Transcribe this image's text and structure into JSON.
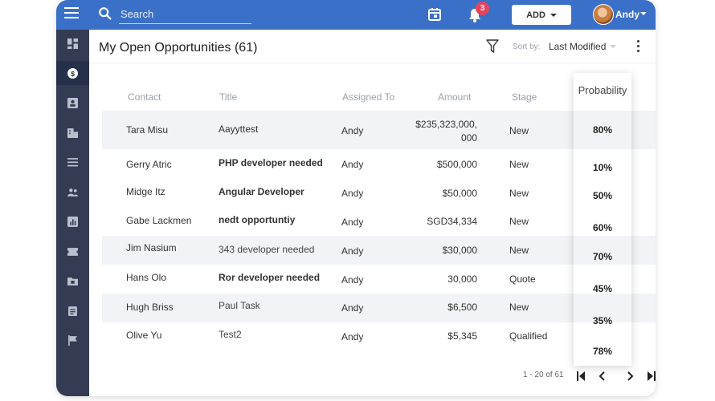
{
  "topbar": {
    "search_placeholder": "Search",
    "notification_count": "3",
    "add_label": "ADD",
    "user_name": "Andy",
    "color": "#3b70c9"
  },
  "sidebar": {
    "items": [
      {
        "icon": "dashboard-icon"
      },
      {
        "icon": "dollar-icon",
        "active": true
      },
      {
        "icon": "contact-card-icon"
      },
      {
        "icon": "building-icon"
      },
      {
        "icon": "list-icon"
      },
      {
        "icon": "people-icon"
      },
      {
        "icon": "report-icon"
      },
      {
        "icon": "ticket-icon"
      },
      {
        "icon": "folder-icon"
      },
      {
        "icon": "clipboard-icon"
      },
      {
        "icon": "flag-icon"
      }
    ]
  },
  "header": {
    "title": "My Open Opportunities (61)",
    "sort_label": "Sort by:",
    "sort_value": "Last Modified"
  },
  "table": {
    "columns": {
      "contact": "Contact",
      "title": "Title",
      "assigned": "Assigned To",
      "amount": "Amount",
      "stage": "Stage",
      "probability": "Probability"
    },
    "rows": [
      {
        "contact": "Tara Misu",
        "title": "Aayyttest",
        "assigned": "Andy",
        "amount_line1": "$235,323,000,",
        "amount_line2": "000",
        "stage": "New",
        "probability": "80%"
      },
      {
        "contact": "Gerry Atric",
        "title": "PHP developer needed",
        "assigned": "Andy",
        "amount": "$500,000",
        "stage": "New",
        "probability": "10%"
      },
      {
        "contact": "Midge Itz",
        "title": "Angular Developer",
        "assigned": "Andy",
        "amount": "$50,000",
        "stage": "New",
        "probability": "50%"
      },
      {
        "contact": "Gabe Lackmen",
        "title": "nedt opportuntiy",
        "assigned": "Andy",
        "amount": "SGD34,334",
        "stage": "New",
        "probability": "60%"
      },
      {
        "contact": "Jim Nasium",
        "title": "343 developer needed",
        "assigned": "Andy",
        "amount": "$30,000",
        "stage": "New",
        "probability": "70%"
      },
      {
        "contact": "Hans Olo",
        "title": "Ror developer needed",
        "assigned": "Andy",
        "amount": "30,000",
        "stage": "Quote",
        "probability": "45%"
      },
      {
        "contact": "Hugh Briss",
        "title": "Paul Task",
        "assigned": "Andy",
        "amount": "$6,500",
        "stage": "New",
        "probability": "35%"
      },
      {
        "contact": "Olive Yu",
        "title": "Test2",
        "assigned": "Andy",
        "amount": "$5,345",
        "stage": "Qualified",
        "probability": "78%"
      }
    ]
  },
  "pager": {
    "range": "1 - 20 of 61"
  }
}
